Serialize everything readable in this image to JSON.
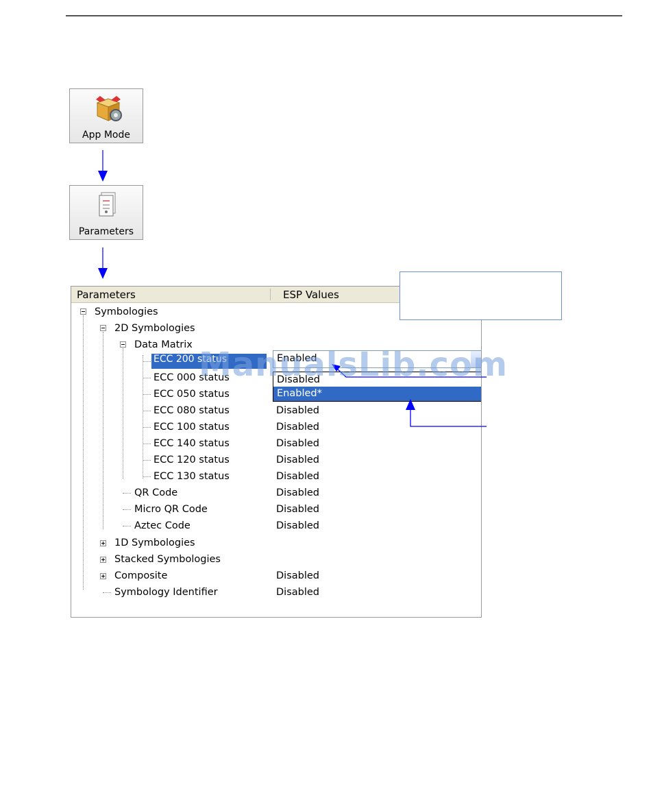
{
  "toolbar": {
    "app_mode": {
      "label": "App Mode",
      "icon": "box-gear-icon"
    },
    "parameters": {
      "label": "Parameters",
      "icon": "document-icon"
    }
  },
  "tree": {
    "columns": [
      "Parameters",
      "ESP Values"
    ],
    "items": [
      {
        "label": "Symbologies",
        "value": "",
        "expander": "minus"
      },
      {
        "label": "2D Symbologies",
        "value": "",
        "expander": "minus"
      },
      {
        "label": "Data Matrix",
        "value": "",
        "expander": "minus"
      },
      {
        "label": "ECC 200 status",
        "value": "Enabled",
        "selected": true
      },
      {
        "label": "ECC 000 status",
        "value": ""
      },
      {
        "label": "ECC 050 status",
        "value": ""
      },
      {
        "label": "ECC 080 status",
        "value": "Disabled"
      },
      {
        "label": "ECC 100 status",
        "value": "Disabled"
      },
      {
        "label": "ECC 140 status",
        "value": "Disabled"
      },
      {
        "label": "ECC 120 status",
        "value": "Disabled"
      },
      {
        "label": "ECC 130 status",
        "value": "Disabled"
      },
      {
        "label": "QR Code",
        "value": "Disabled"
      },
      {
        "label": "Micro QR Code",
        "value": "Disabled"
      },
      {
        "label": "Aztec Code",
        "value": "Disabled"
      },
      {
        "label": "1D Symbologies",
        "value": "",
        "expander": "plus"
      },
      {
        "label": "Stacked Symbologies",
        "value": "",
        "expander": "plus"
      },
      {
        "label": "Composite",
        "value": "Disabled",
        "expander": "plus"
      },
      {
        "label": "Symbology Identifier",
        "value": "Disabled"
      }
    ]
  },
  "dropdown": {
    "current": "Enabled",
    "options": [
      "Disabled",
      "Enabled*"
    ],
    "highlighted_index": 1
  },
  "watermark": "ManualsLib.com",
  "colors": {
    "selection": "#316ac5",
    "arrow": "#0000ff",
    "header": "#ece9d8"
  }
}
